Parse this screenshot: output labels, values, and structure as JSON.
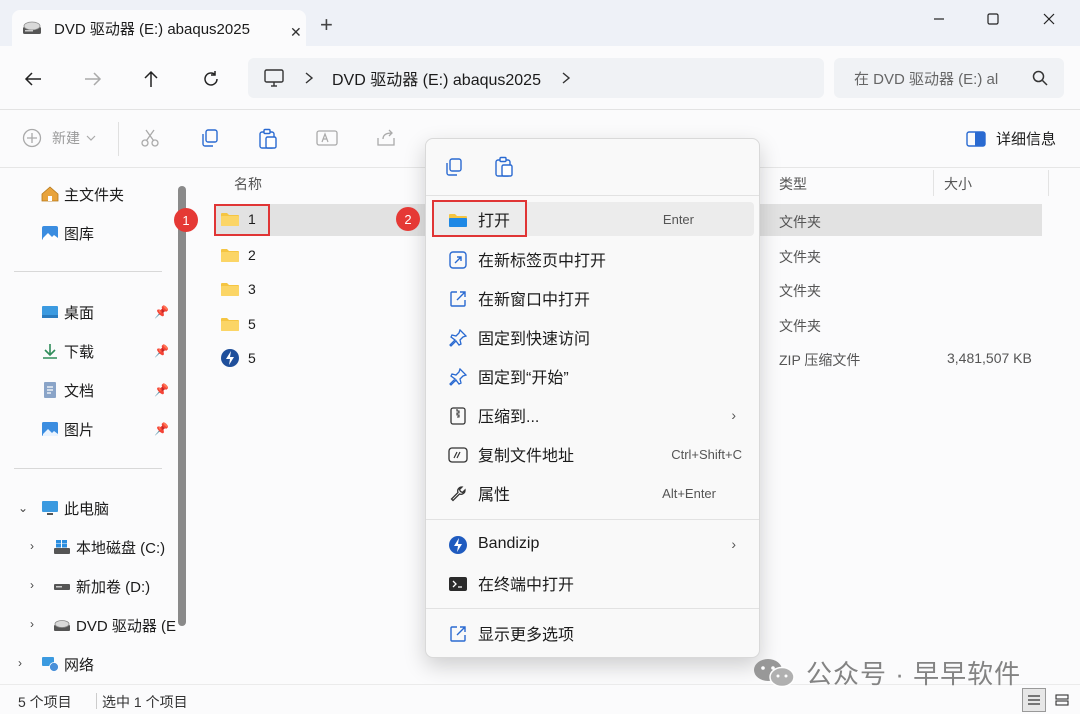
{
  "window": {
    "tab_title": "DVD 驱动器 (E:) abaqus2025",
    "tab_close": "✕",
    "new_tab": "+"
  },
  "address": {
    "path_segment": "DVD 驱动器 (E:) abaqus2025",
    "search_placeholder": "在 DVD 驱动器 (E:) al"
  },
  "toolbar": {
    "new_label": "新建",
    "details_label": "详细信息"
  },
  "sidebar": {
    "home": "主文件夹",
    "gallery": "图库",
    "desktop": "桌面",
    "downloads": "下载",
    "documents": "文档",
    "pictures": "图片",
    "this_pc": "此电脑",
    "local_disk": "本地磁盘 (C:)",
    "new_volume": "新加卷 (D:)",
    "dvd_drive": "DVD 驱动器 (E",
    "network": "网络"
  },
  "columns": {
    "name": "名称",
    "type": "类型",
    "size": "大小"
  },
  "files": [
    {
      "name": "1",
      "type": "文件夹",
      "size": ""
    },
    {
      "name": "2",
      "type": "文件夹",
      "size": ""
    },
    {
      "name": "3",
      "type": "文件夹",
      "size": ""
    },
    {
      "name": "5",
      "type": "文件夹",
      "size": ""
    },
    {
      "name": "5",
      "type": "ZIP 压缩文件",
      "size": "3,481,507 KB"
    }
  ],
  "context_menu": {
    "open": "打开",
    "open_key": "Enter",
    "open_new_tab": "在新标签页中打开",
    "open_new_window": "在新窗口中打开",
    "pin_quick_access": "固定到快速访问",
    "pin_start": "固定到“开始”",
    "compress_to": "压缩到...",
    "copy_path": "复制文件地址",
    "copy_path_key": "Ctrl+Shift+C",
    "properties": "属性",
    "properties_key": "Alt+Enter",
    "bandizip": "Bandizip",
    "open_terminal": "在终端中打开",
    "show_more": "显示更多选项"
  },
  "annotations": {
    "badge1": "1",
    "badge2": "2",
    "annotation_color": "#e03535"
  },
  "status": {
    "item_count": "5 个项目",
    "selected": "选中 1 个项目"
  },
  "watermark": {
    "text": "公众号 · 早早软件"
  },
  "colors": {
    "folder": "#f5c542",
    "accent": "#0067c0"
  }
}
